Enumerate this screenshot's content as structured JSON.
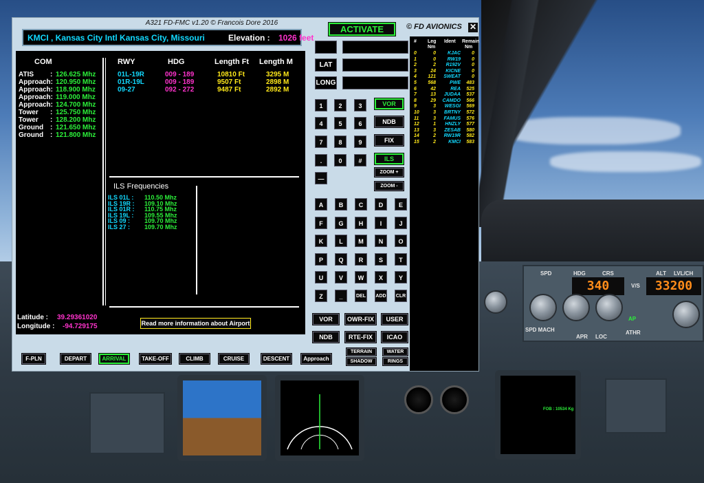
{
  "window": {
    "title": "A321 FD-FMC v1.20  © Francois Dore 2016",
    "brand": "© FD AVIONICS",
    "close_glyph": "✕"
  },
  "airport": {
    "name": "KMCI , Kansas City Intl  Kansas City, Missouri",
    "elevation_label": "Elevation :",
    "elevation_value": "1026 feet"
  },
  "com": {
    "header": "COM",
    "rows": [
      {
        "label": "ATIS",
        "sep": ":",
        "value": "126.625 Mhz"
      },
      {
        "label": "Approach:",
        "sep": "",
        "value": "120.950 Mhz"
      },
      {
        "label": "Approach:",
        "sep": "",
        "value": "118.900 Mhz"
      },
      {
        "label": "Approach:",
        "sep": "",
        "value": "119.000 Mhz"
      },
      {
        "label": "Approach:",
        "sep": "",
        "value": "124.700 Mhz"
      },
      {
        "label": "Tower",
        "sep": ":",
        "value": "125.750 Mhz"
      },
      {
        "label": "Tower",
        "sep": ":",
        "value": "128.200 Mhz"
      },
      {
        "label": "Ground",
        "sep": ":",
        "value": "121.650 Mhz"
      },
      {
        "label": "Ground",
        "sep": ":",
        "value": "121.800 Mhz"
      }
    ]
  },
  "runways": {
    "headers": {
      "rwy": "RWY",
      "hdg": "HDG",
      "len_ft": "Length Ft",
      "len_m": "Length M"
    },
    "rows": [
      {
        "rwy": "01L-19R",
        "hdg": "009 - 189",
        "ft": "10810 Ft",
        "m": "3295 M"
      },
      {
        "rwy": "01R-19L",
        "hdg": "009 - 189",
        "ft": "9507 Ft",
        "m": "2898 M"
      },
      {
        "rwy": "09-27",
        "hdg": "092 - 272",
        "ft": "9487 Ft",
        "m": "2892 M"
      }
    ]
  },
  "ils": {
    "header": "ILS Frequencies",
    "rows": [
      {
        "label": "ILS 01L  :",
        "value": "110.50 Mhz"
      },
      {
        "label": "ILS 19R  :",
        "value": "109.10 Mhz"
      },
      {
        "label": "ILS 01R  :",
        "value": "110.75 Mhz"
      },
      {
        "label": "ILS 19L  :",
        "value": "109.55 Mhz"
      },
      {
        "label": "ILS 09   :",
        "value": "109.70 Mhz"
      },
      {
        "label": "ILS 27   :",
        "value": "109.70 Mhz"
      }
    ]
  },
  "position": {
    "lat_label": "Latitude :",
    "lat_value": "39.29361020",
    "lon_label": "Longitude :",
    "lon_value": "-94.729175"
  },
  "info_link": "Read more information about Airport",
  "input": {
    "activate": "ACTIVATE",
    "lat": "LAT",
    "long": "LONG"
  },
  "keypad": {
    "digits": [
      "1",
      "2",
      "3",
      "4",
      "5",
      "6",
      "7",
      "8",
      "9",
      ".",
      "0",
      "#",
      "—"
    ],
    "nav": {
      "vor": "VOR",
      "ndb": "NDB",
      "fix": "FIX",
      "ils": "ILS",
      "zoom_in": "ZOOM +",
      "zoom_out": "ZOOM -"
    },
    "letters": [
      "A",
      "B",
      "C",
      "D",
      "E",
      "F",
      "G",
      "H",
      "I",
      "J",
      "K",
      "L",
      "M",
      "N",
      "O",
      "P",
      "Q",
      "R",
      "S",
      "T",
      "U",
      "V",
      "W",
      "X",
      "Y",
      "Z",
      "_",
      "DEL",
      "ADD",
      "CLR"
    ]
  },
  "lookup": {
    "vor": "VOR",
    "owr_fix": "OWR-FIX",
    "user": "USER",
    "ndb": "NDB",
    "rte_fix": "RTE-FIX",
    "icao": "ICAO",
    "terrain": "TERRAIN",
    "water": "WATER",
    "shadow": "SHADOW",
    "rings": "RINGS"
  },
  "pages": [
    "F-PLN",
    "DEPART",
    "ARRIVAL",
    "TAKE-OFF",
    "CLIMB",
    "CRUISE",
    "DESCENT",
    "Approach"
  ],
  "legs": {
    "headers": {
      "num": "#",
      "leg": "Leg",
      "ident": "Ident",
      "remain": "Remain",
      "nm1": "Nm",
      "nm2": "Nm"
    },
    "rows": [
      {
        "n": "0",
        "leg": "0",
        "id": "KJAC",
        "rem": "0"
      },
      {
        "n": "1",
        "leg": "0",
        "id": "RW19",
        "rem": "0"
      },
      {
        "n": "2",
        "leg": "2",
        "id": "R192V",
        "rem": "0"
      },
      {
        "n": "3",
        "leg": "24",
        "id": "KICNE",
        "rem": "0"
      },
      {
        "n": "4",
        "leg": "121",
        "id": "SWEAT",
        "rem": "0"
      },
      {
        "n": "5",
        "leg": "568",
        "id": "PWE",
        "rem": "483"
      },
      {
        "n": "6",
        "leg": "42",
        "id": "REA",
        "rem": "525"
      },
      {
        "n": "7",
        "leg": "13",
        "id": "JUDAA",
        "rem": "537"
      },
      {
        "n": "8",
        "leg": "29",
        "id": "CAMDO",
        "rem": "566"
      },
      {
        "n": "9",
        "leg": "3",
        "id": "WESGI",
        "rem": "569"
      },
      {
        "n": "10",
        "leg": "3",
        "id": "BRTNY",
        "rem": "572"
      },
      {
        "n": "11",
        "leg": "3",
        "id": "FAMUS",
        "rem": "576"
      },
      {
        "n": "12",
        "leg": "1",
        "id": "HNZLY",
        "rem": "577"
      },
      {
        "n": "13",
        "leg": "3",
        "id": "ZESAB",
        "rem": "580"
      },
      {
        "n": "14",
        "leg": "2",
        "id": "RW19R",
        "rem": "582"
      },
      {
        "n": "15",
        "leg": "2",
        "id": "KMCI",
        "rem": "583"
      }
    ]
  },
  "cockpit": {
    "fcu_spd": "SPD",
    "fcu_hdg": "HDG",
    "fcu_crs": "CRS",
    "fcu_crs_value": "340",
    "fcu_alt": "ALT",
    "fcu_alt_value": "33200",
    "fcu_lvl": "LVL/CH",
    "fcu_vs": "V/S",
    "fcu_spd_mach": "SPD MACH",
    "fcu_ap": "AP",
    "fcu_athr": "ATHR",
    "fcu_apr": "APR",
    "fcu_loc": "LOC",
    "fob_label": "FOB :",
    "fob_value": "10534 Kg"
  }
}
